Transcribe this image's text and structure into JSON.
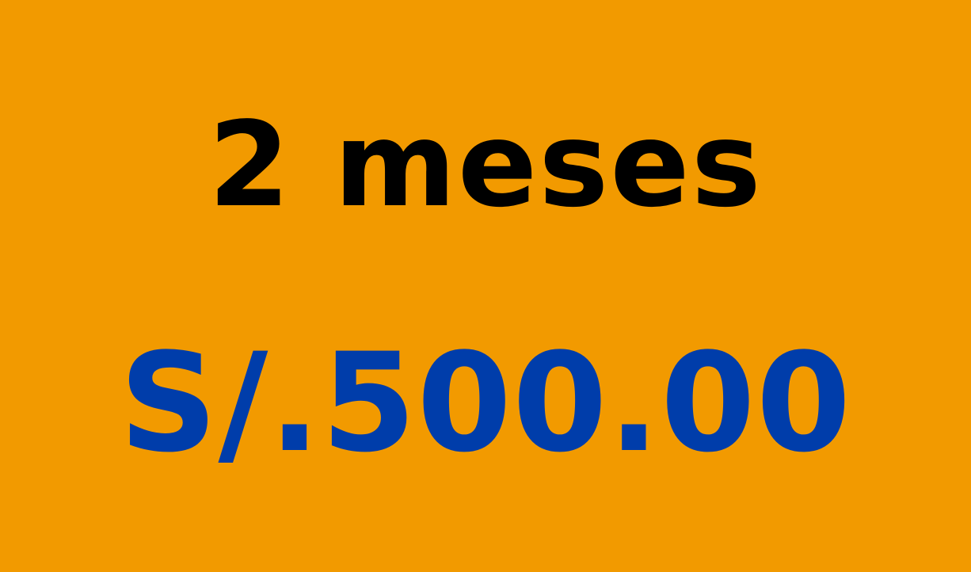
{
  "card": {
    "duration_text": "2 meses",
    "price_text": "S/.500.00"
  },
  "colors": {
    "background": "#F29A00",
    "duration_text": "#000000",
    "price_text": "#003DAA"
  }
}
